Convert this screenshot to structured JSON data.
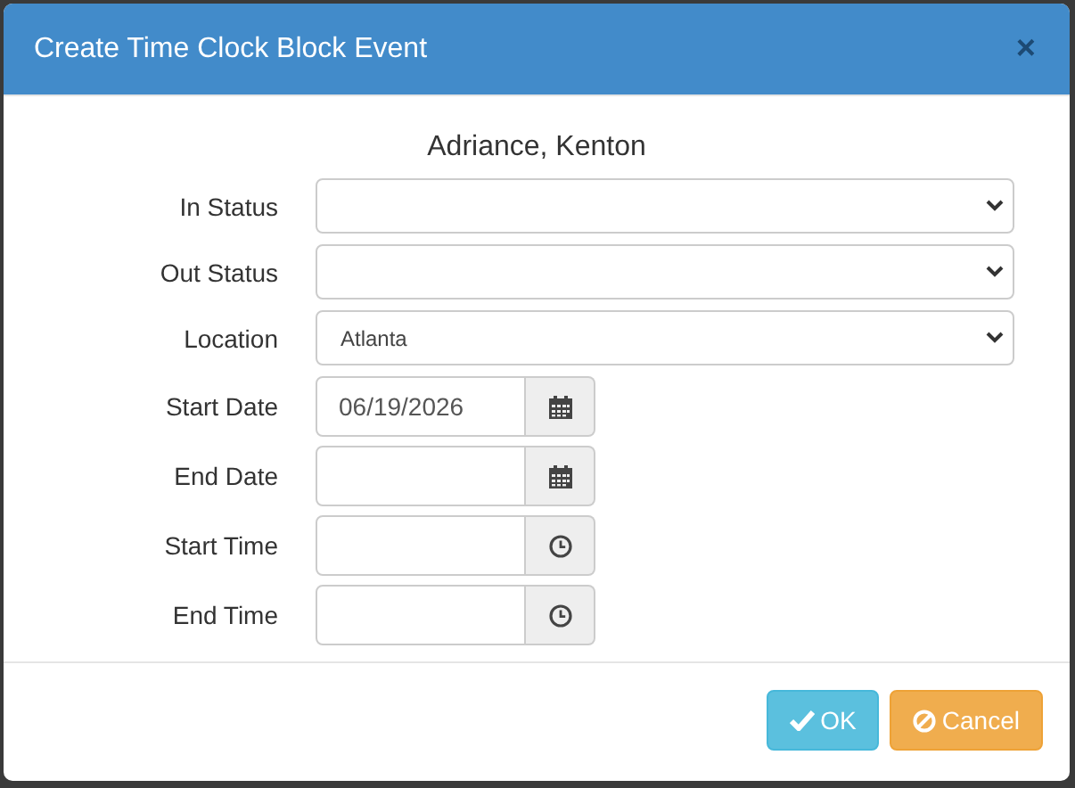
{
  "dialog": {
    "title": "Create Time Clock Block Event",
    "close": "×"
  },
  "employee": "Adriance, Kenton",
  "fields": [
    {
      "label": "In Status",
      "kind": "select"
    },
    {
      "label": "Out Status",
      "kind": "select"
    },
    {
      "label": "Location",
      "kind": "select",
      "value": "Atlanta"
    },
    {
      "label": "Start Date",
      "kind": "date",
      "value": "06/19/2026"
    },
    {
      "label": "End Date",
      "kind": "date"
    },
    {
      "label": "Start Time",
      "kind": "time"
    },
    {
      "label": "End Time",
      "kind": "time"
    }
  ],
  "buttons": [
    {
      "label": "OK",
      "kind": "ok"
    },
    {
      "label": "Cancel",
      "kind": "cancel"
    }
  ]
}
